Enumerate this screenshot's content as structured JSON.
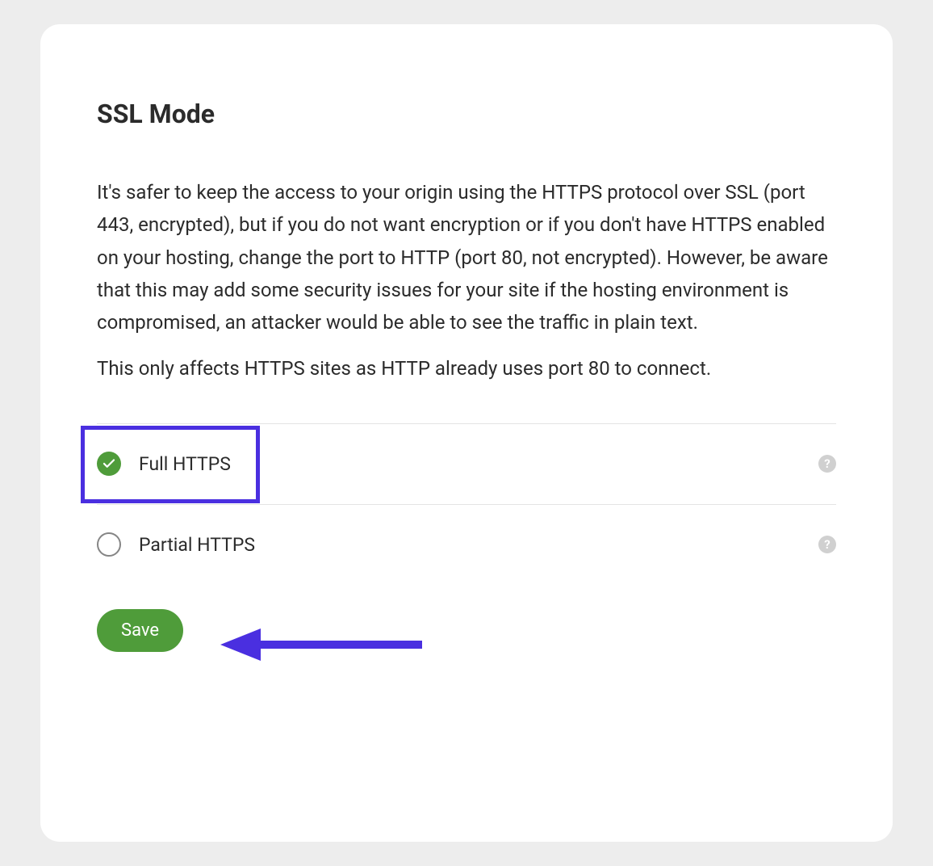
{
  "title": "SSL Mode",
  "description_p1": "It's safer to keep the access to your origin using the HTTPS protocol over SSL (port 443, encrypted), but if you do not want encryption or if you don't have HTTPS enabled on your hosting, change the port to HTTP (port 80, not encrypted). However, be aware that this may add some security issues for your site if the hosting environment is compromised, an attacker would be able to see the traffic in plain text.",
  "description_p2": "This only affects HTTPS sites as HTTP already uses port 80 to connect.",
  "options": {
    "full_label": "Full HTTPS",
    "partial_label": "Partial HTTPS"
  },
  "save_label": "Save",
  "help_glyph": "?",
  "colors": {
    "accent_green": "#4f9c3a",
    "highlight_purple": "#4a2fe0"
  }
}
